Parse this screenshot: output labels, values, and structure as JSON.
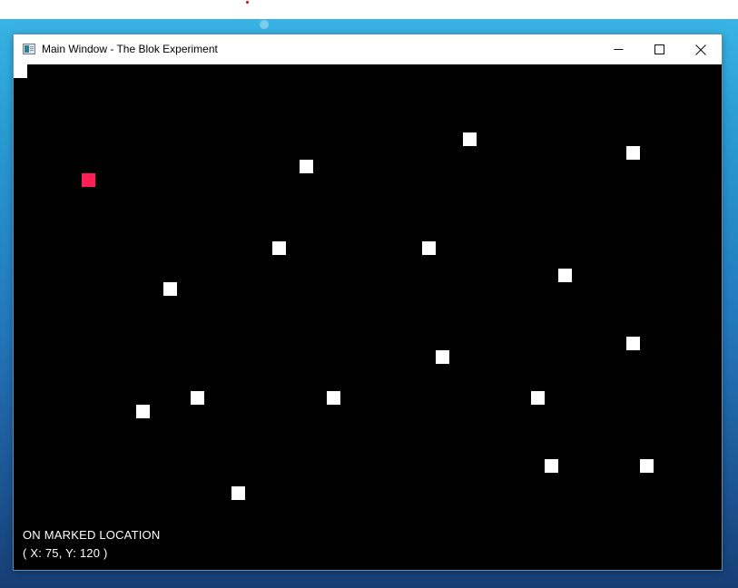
{
  "desktop": {
    "background_top": "#3bb8e6",
    "background_bottom": "#163e74"
  },
  "window": {
    "title": "Main Window - The Blok Experiment",
    "controls": {
      "minimize": "minimize-icon",
      "maximize": "maximize-icon",
      "close": "close-icon"
    }
  },
  "game": {
    "background_color": "#000000",
    "blok_color": "#ffffff",
    "marked_color": "#ff1f55",
    "status": {
      "line1": "ON MARKED LOCATION",
      "line2": "( X: 75, Y: 120 )"
    }
  }
}
